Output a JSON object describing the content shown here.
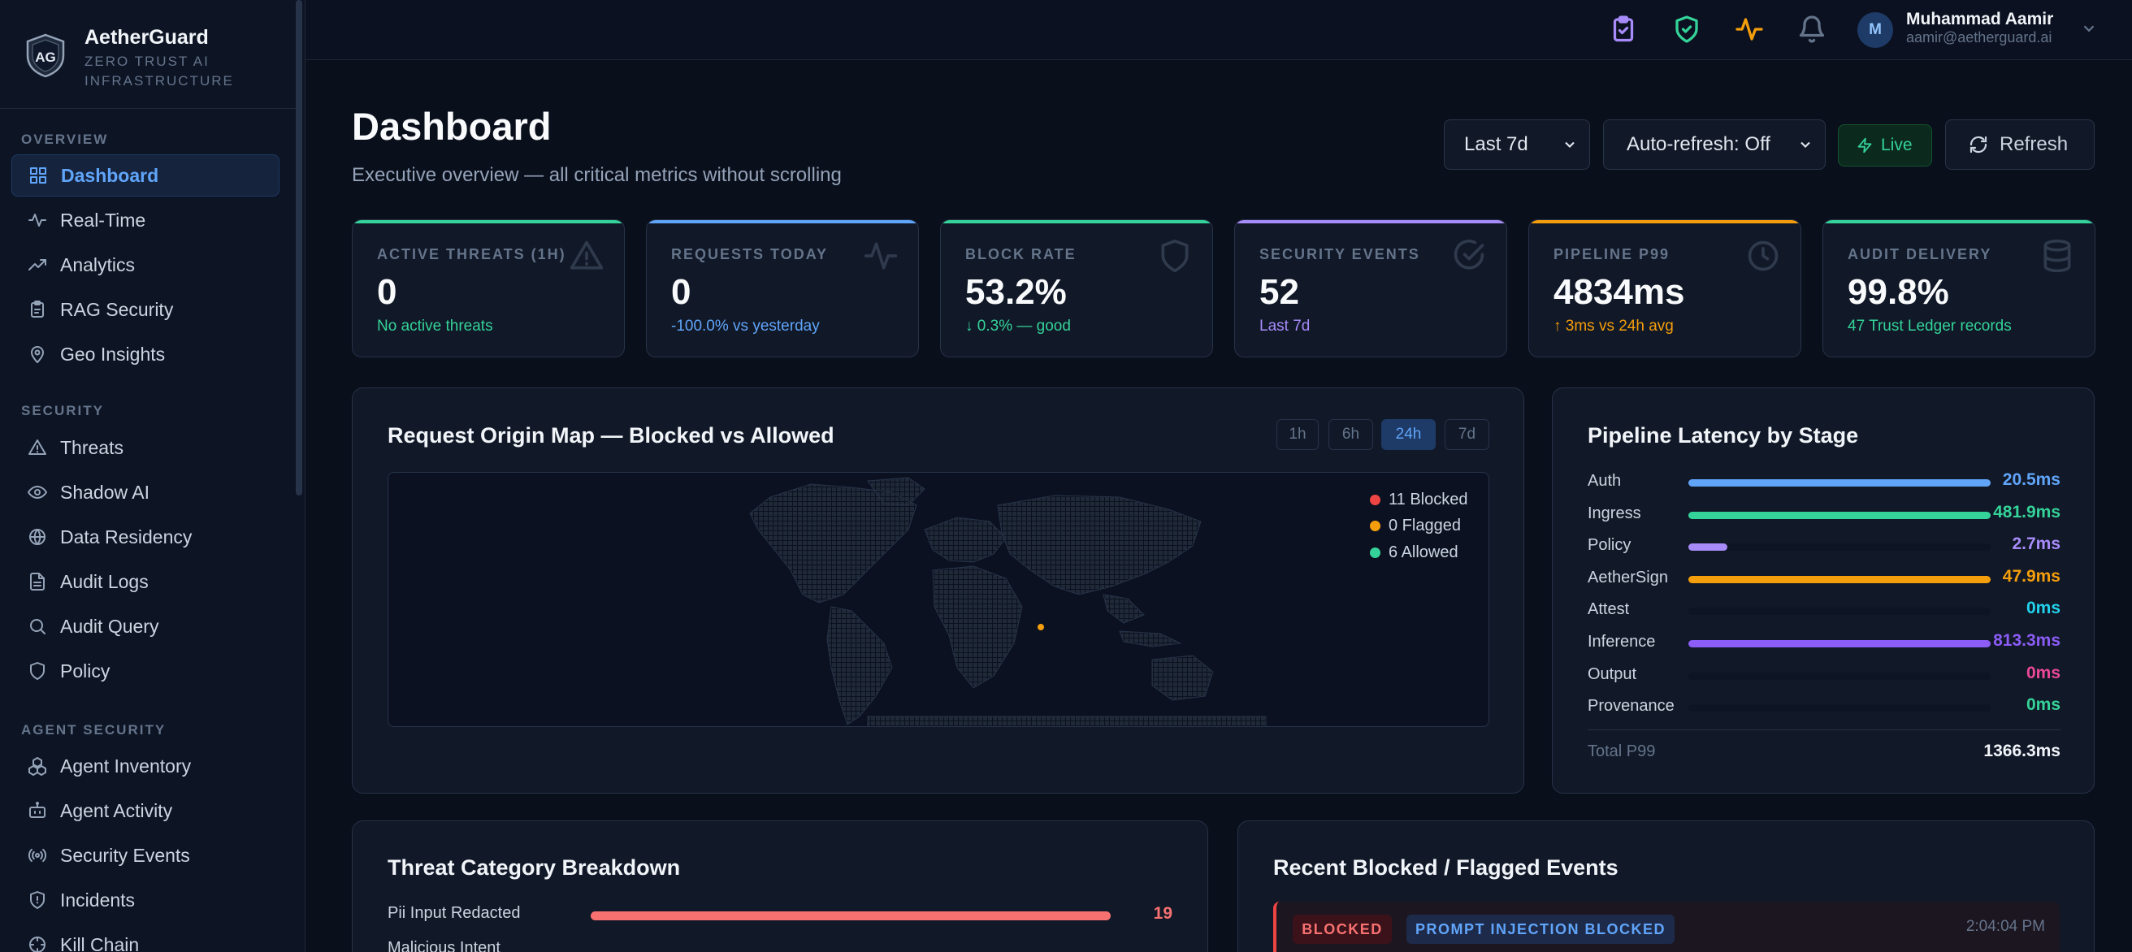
{
  "brand": {
    "name": "AetherGuard",
    "tagline": "ZERO TRUST AI INFRASTRUCTURE",
    "logo_text": "AG"
  },
  "sidebar": {
    "sections": [
      {
        "label": "OVERVIEW",
        "items": [
          {
            "label": "Dashboard",
            "icon": "grid-icon",
            "active": true
          },
          {
            "label": "Real-Time",
            "icon": "activity-icon"
          },
          {
            "label": "Analytics",
            "icon": "trending-icon"
          },
          {
            "label": "RAG Security",
            "icon": "clipboard-icon"
          },
          {
            "label": "Geo Insights",
            "icon": "map-pin-icon"
          }
        ]
      },
      {
        "label": "SECURITY",
        "items": [
          {
            "label": "Threats",
            "icon": "alert-triangle-icon"
          },
          {
            "label": "Shadow AI",
            "icon": "eye-icon"
          },
          {
            "label": "Data Residency",
            "icon": "globe-icon"
          },
          {
            "label": "Audit Logs",
            "icon": "file-text-icon"
          },
          {
            "label": "Audit Query",
            "icon": "search-icon"
          },
          {
            "label": "Policy",
            "icon": "shield-icon"
          }
        ]
      },
      {
        "label": "AGENT SECURITY",
        "items": [
          {
            "label": "Agent Inventory",
            "icon": "boxes-icon"
          },
          {
            "label": "Agent Activity",
            "icon": "bot-icon"
          },
          {
            "label": "Security Events",
            "icon": "radio-icon"
          },
          {
            "label": "Incidents",
            "icon": "shield-alert-icon"
          },
          {
            "label": "Kill Chain",
            "icon": "crosshair-icon"
          }
        ]
      }
    ]
  },
  "topbar": {
    "icons": [
      "clipboard-check-icon",
      "shield-check-icon",
      "pulse-icon",
      "bell-icon"
    ],
    "user": {
      "initial": "M",
      "name": "Muhammad Aamir",
      "email": "aamir@aetherguard.ai"
    }
  },
  "header": {
    "title": "Dashboard",
    "subtitle": "Executive overview — all critical metrics without scrolling",
    "range": "Last 7d",
    "autorefresh": "Auto-refresh: Off",
    "live": "Live",
    "refresh": "Refresh"
  },
  "kpis": [
    {
      "label": "ACTIVE THREATS (1H)",
      "value": "0",
      "sub": "No active threats",
      "accent": "#34d399",
      "sub_color": "#34d399",
      "icon": "alert-triangle-icon"
    },
    {
      "label": "REQUESTS TODAY",
      "value": "0",
      "sub": "-100.0% vs yesterday",
      "accent": "#60a5fa",
      "sub_color": "#60a5fa",
      "icon": "pulse-icon"
    },
    {
      "label": "BLOCK RATE",
      "value": "53.2%",
      "sub": "↓ 0.3% — good",
      "accent": "#34d399",
      "sub_color": "#34d399",
      "icon": "shield-icon"
    },
    {
      "label": "SECURITY EVENTS",
      "value": "52",
      "sub": "Last 7d",
      "accent": "#a78bfa",
      "sub_color": "#a78bfa",
      "icon": "check-circle-icon"
    },
    {
      "label": "PIPELINE P99",
      "value": "4834ms",
      "sub": "↑ 3ms vs 24h avg",
      "accent": "#f59e0b",
      "sub_color": "#f59e0b",
      "icon": "clock-icon"
    },
    {
      "label": "AUDIT DELIVERY",
      "value": "99.8%",
      "sub": "47 Trust Ledger records",
      "accent": "#34d399",
      "sub_color": "#34d399",
      "icon": "database-icon"
    }
  ],
  "map": {
    "title": "Request Origin Map — Blocked vs Allowed",
    "ranges": [
      "1h",
      "6h",
      "24h",
      "7d"
    ],
    "active_range": "24h",
    "legend": [
      {
        "label": "11 Blocked",
        "color": "#ef4444"
      },
      {
        "label": "0 Flagged",
        "color": "#f59e0b"
      },
      {
        "label": "6 Allowed",
        "color": "#34d399"
      }
    ]
  },
  "latency": {
    "title": "Pipeline Latency by Stage",
    "stages": [
      {
        "name": "Auth",
        "value": "20.5ms",
        "fill": 1.0,
        "color": "#60a5fa"
      },
      {
        "name": "Ingress",
        "value": "481.9ms",
        "fill": 1.0,
        "color": "#34d399"
      },
      {
        "name": "Policy",
        "value": "2.7ms",
        "fill": 0.13,
        "color": "#a78bfa"
      },
      {
        "name": "AetherSign",
        "value": "47.9ms",
        "fill": 1.0,
        "color": "#f59e0b"
      },
      {
        "name": "Attest",
        "value": "0ms",
        "fill": 0,
        "color": "#22d3ee"
      },
      {
        "name": "Inference",
        "value": "813.3ms",
        "fill": 1.0,
        "color": "#8b5cf6"
      },
      {
        "name": "Output",
        "value": "0ms",
        "fill": 0,
        "color": "#ec4899"
      },
      {
        "name": "Provenance",
        "value": "0ms",
        "fill": 0,
        "color": "#34d399"
      }
    ],
    "total_label": "Total P99",
    "total_value": "1366.3ms"
  },
  "threats": {
    "title": "Threat Category Breakdown",
    "items": [
      {
        "name": "Pii Input Redacted",
        "value": "19",
        "fill": 1.0
      },
      {
        "name": "Malicious Intent",
        "value": "",
        "fill": 0
      }
    ]
  },
  "events": {
    "title": "Recent Blocked / Flagged Events",
    "items": [
      {
        "status": "BLOCKED",
        "type": "PROMPT INJECTION BLOCKED",
        "time": "2:04:04 PM"
      }
    ]
  }
}
